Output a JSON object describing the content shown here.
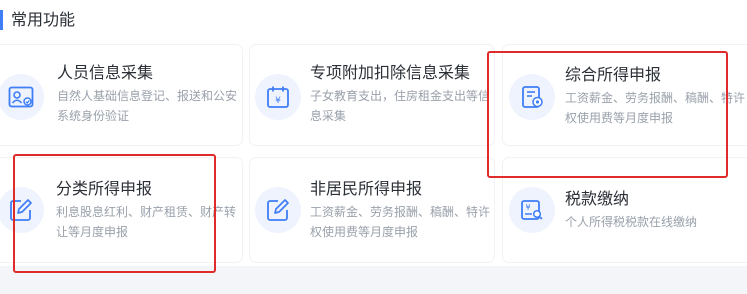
{
  "section": {
    "title": "常用功能"
  },
  "cards": [
    {
      "title": "人员信息采集",
      "desc": "自然人基础信息登记、报送和公安系统身份验证",
      "icon": "person-card-icon"
    },
    {
      "title": "专项附加扣除信息采集",
      "desc": "子女教育支出，住房租金支出等信息采集",
      "icon": "calendar-doc-icon"
    },
    {
      "title": "综合所得申报",
      "desc": "工资薪金、劳务报酬、稿酬、特许权使用费等月度申报",
      "icon": "doc-coin-icon"
    },
    {
      "title": "分类所得申报",
      "desc": "利息股息红利、财产租赁、财产转让等月度申报",
      "icon": "edit-icon"
    },
    {
      "title": "非居民所得申报",
      "desc": "工资薪金、劳务报酬、稿酬、特许权使用费等月度申报",
      "icon": "edit-icon"
    },
    {
      "title": "税款缴纳",
      "desc": "个人所得税税款在线缴纳",
      "icon": "tax-payment-icon"
    }
  ],
  "colors": {
    "accent": "#3f7ef6",
    "highlight": "#e02b2b",
    "icon_bg": "#eef3fd"
  }
}
